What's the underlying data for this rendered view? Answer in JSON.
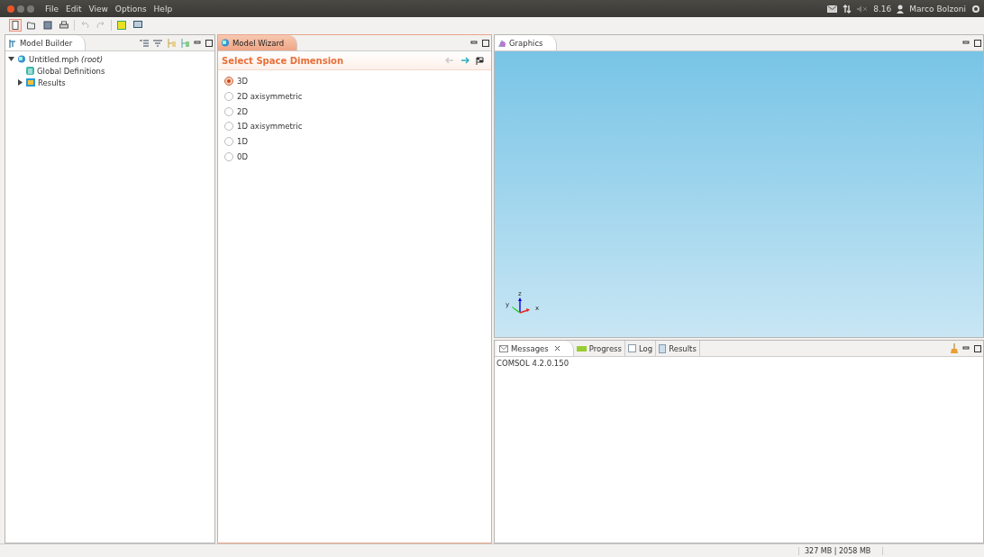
{
  "menu_bar": {
    "menus": [
      "File",
      "Edit",
      "View",
      "Options",
      "Help"
    ],
    "time": "8.16",
    "user": "Marco Bolzoni"
  },
  "model_builder": {
    "title": "Model Builder",
    "tree": [
      {
        "label": "Untitled.mph",
        "suffix": "(root)",
        "expanded": true,
        "children": [
          {
            "label": "Global Definitions",
            "kind": "definitions"
          },
          {
            "label": "Results",
            "kind": "results",
            "expanded": false
          }
        ],
        "kind": "model"
      }
    ]
  },
  "model_wizard": {
    "title": "Model Wizard",
    "heading": "Select Space Dimension",
    "options": [
      {
        "label": "3D",
        "selected": true
      },
      {
        "label": "2D axisymmetric",
        "selected": false
      },
      {
        "label": "2D",
        "selected": false
      },
      {
        "label": "1D axisymmetric",
        "selected": false
      },
      {
        "label": "1D",
        "selected": false
      },
      {
        "label": "0D",
        "selected": false
      }
    ]
  },
  "graphics": {
    "title": "Graphics",
    "axes": {
      "x": "x",
      "y": "y",
      "z": "z"
    }
  },
  "messages": {
    "tabs": [
      {
        "label": "Messages",
        "selected": true,
        "kind": "messages"
      },
      {
        "label": "Progress",
        "selected": false,
        "kind": "progress"
      },
      {
        "label": "Log",
        "selected": false,
        "kind": "log"
      },
      {
        "label": "Results",
        "selected": false,
        "kind": "results"
      }
    ],
    "text": "COMSOL 4.2.0.150"
  },
  "status_bar": {
    "memory": "327 MB | 2058 MB"
  }
}
